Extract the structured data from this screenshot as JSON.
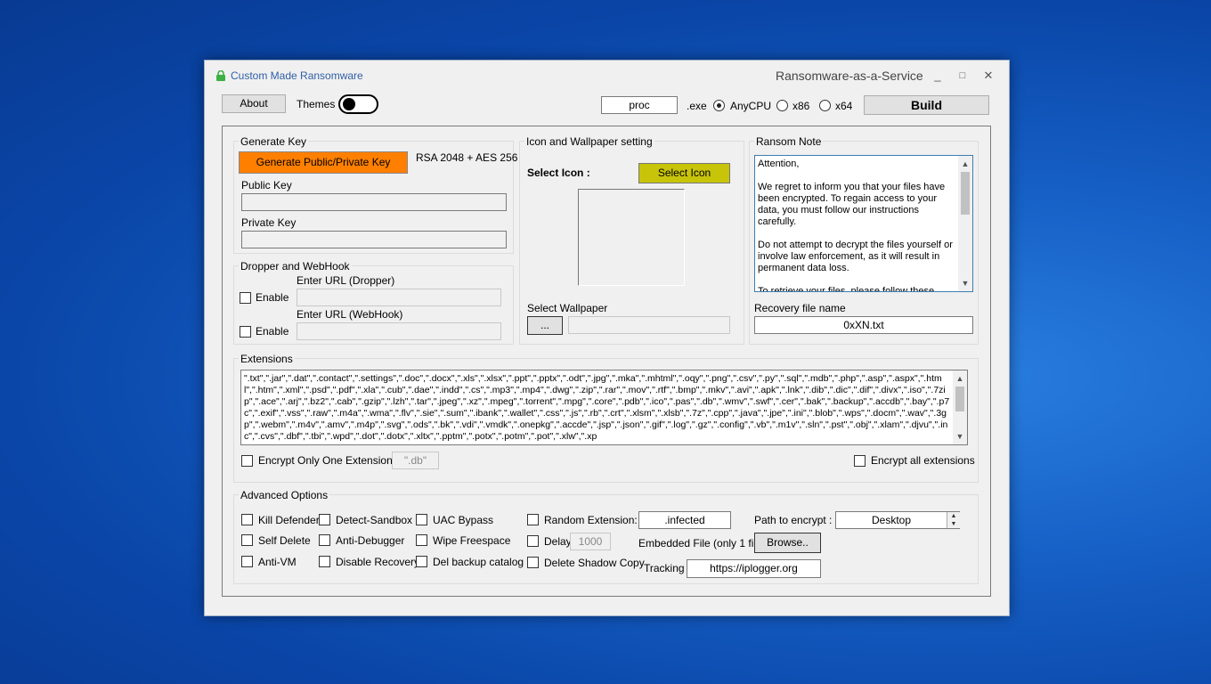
{
  "window": {
    "title": "Custom Made Ransomware",
    "subtitle": "Ransomware-as-a-Service",
    "minimize": "_",
    "maximize": "□",
    "close": "✕"
  },
  "toolbar": {
    "about_label": "About",
    "themes_label": "Themes",
    "exe_name": "proc",
    "exe_suffix": ".exe",
    "platform_options": [
      "AnyCPU",
      "x86",
      "x64"
    ],
    "selected_platform": "AnyCPU",
    "build_label": "Build"
  },
  "generate_key": {
    "group_title": "Generate Key",
    "button_label": "Generate Public/Private Key",
    "algo_label": "RSA 2048 + AES 256",
    "public_key_label": "Public Key",
    "public_key_value": "",
    "private_key_label": "Private Key",
    "private_key_value": ""
  },
  "dropper": {
    "group_title": "Dropper and WebHook",
    "enable_label": "Enable",
    "dropper_url_label": "Enter URL (Dropper)",
    "webhook_url_label": "Enter URL (WebHook)"
  },
  "icon_wallpaper": {
    "group_title": "Icon and Wallpaper setting",
    "select_icon_label": "Select Icon :",
    "select_icon_button": "Select Icon",
    "select_wallpaper_label": "Select Wallpaper",
    "browse_dots": "..."
  },
  "ransom_note": {
    "group_title": "Ransom Note",
    "text": "Attention,\n\nWe regret to inform you that your files have been encrypted. To regain access to your data, you must follow our instructions carefully.\n\nDo not attempt to decrypt the files yourself or involve law enforcement, as it will result in permanent data loss.\n\nTo retrieve your files, please follow these simple",
    "recovery_label": "Recovery file name",
    "recovery_value": "0xXN.txt"
  },
  "extensions": {
    "group_title": "Extensions",
    "list": "\".txt\",\".jar\",\".dat\",\".contact\",\".settings\",\".doc\",\".docx\",\".xls\",\".xlsx\",\".ppt\",\".pptx\",\".odt\",\".jpg\",\".mka\",\".mhtml\",\".oqy\",\".png\",\".csv\",\".py\",\".sql\",\".mdb\",\".php\",\".asp\",\".aspx\",\".html\",\".htm\",\".xml\",\".psd\",\".pdf\",\".xla\",\".cub\",\".dae\",\".indd\",\".cs\",\".mp3\",\".mp4\",\".dwg\",\".zip\",\".rar\",\".mov\",\".rtf\",\".bmp\",\".mkv\",\".avi\",\".apk\",\".lnk\",\".dib\",\".dic\",\".dif\",\".divx\",\".iso\",\".7zip\",\".ace\",\".arj\",\".bz2\",\".cab\",\".gzip\",\".lzh\",\".tar\",\".jpeg\",\".xz\",\".mpeg\",\".torrent\",\".mpg\",\".core\",\".pdb\",\".ico\",\".pas\",\".db\",\".wmv\",\".swf\",\".cer\",\".bak\",\".backup\",\".accdb\",\".bay\",\".p7c\",\".exif\",\".vss\",\".raw\",\".m4a\",\".wma\",\".flv\",\".sie\",\".sum\",\".ibank\",\".wallet\",\".css\",\".js\",\".rb\",\".crt\",\".xlsm\",\".xlsb\",\".7z\",\".cpp\",\".java\",\".jpe\",\".ini\",\".blob\",\".wps\",\".docm\",\".wav\",\".3gp\",\".webm\",\".m4v\",\".amv\",\".m4p\",\".svg\",\".ods\",\".bk\",\".vdi\",\".vmdk\",\".onepkg\",\".accde\",\".jsp\",\".json\",\".gif\",\".log\",\".gz\",\".config\",\".vb\",\".m1v\",\".sln\",\".pst\",\".obj\",\".xlam\",\".djvu\",\".inc\",\".cvs\",\".dbf\",\".tbi\",\".wpd\",\".dot\",\".dotx\",\".xltx\",\".pptm\",\".potx\",\".potm\",\".pot\",\".xlw\",\".xp",
    "one_ext_label": "Encrypt Only One Extensions",
    "one_ext_value": "\".db\"",
    "all_ext_label": "Encrypt all extensions"
  },
  "advanced": {
    "group_title": "Advanced Options",
    "kill_defender": "Kill Defender",
    "detect_sandbox": "Detect-Sandbox",
    "uac_bypass": "UAC Bypass",
    "random_extension": "Random Extension:",
    "random_extension_value": ".infected",
    "path_label": "Path to encrypt :",
    "path_value": "Desktop",
    "self_delete": "Self Delete",
    "anti_debugger": "Anti-Debugger",
    "wipe_freespace": "Wipe Freespace",
    "delay": "Delay",
    "delay_value": "1000",
    "embedded_file": "Embedded File (only 1 file)",
    "browse": "Browse..",
    "anti_vm": "Anti-VM",
    "disable_recovery": "Disable Recovery",
    "del_backup": "Del backup catalog",
    "delete_shadow": "Delete Shadow Copy",
    "tracking": "Tracking",
    "tracking_value": "https://iplogger.org"
  },
  "colors": {
    "generate_button": "#ff7f00",
    "select_icon_button": "#c7c40a",
    "title_text": "#2f5fa7"
  }
}
